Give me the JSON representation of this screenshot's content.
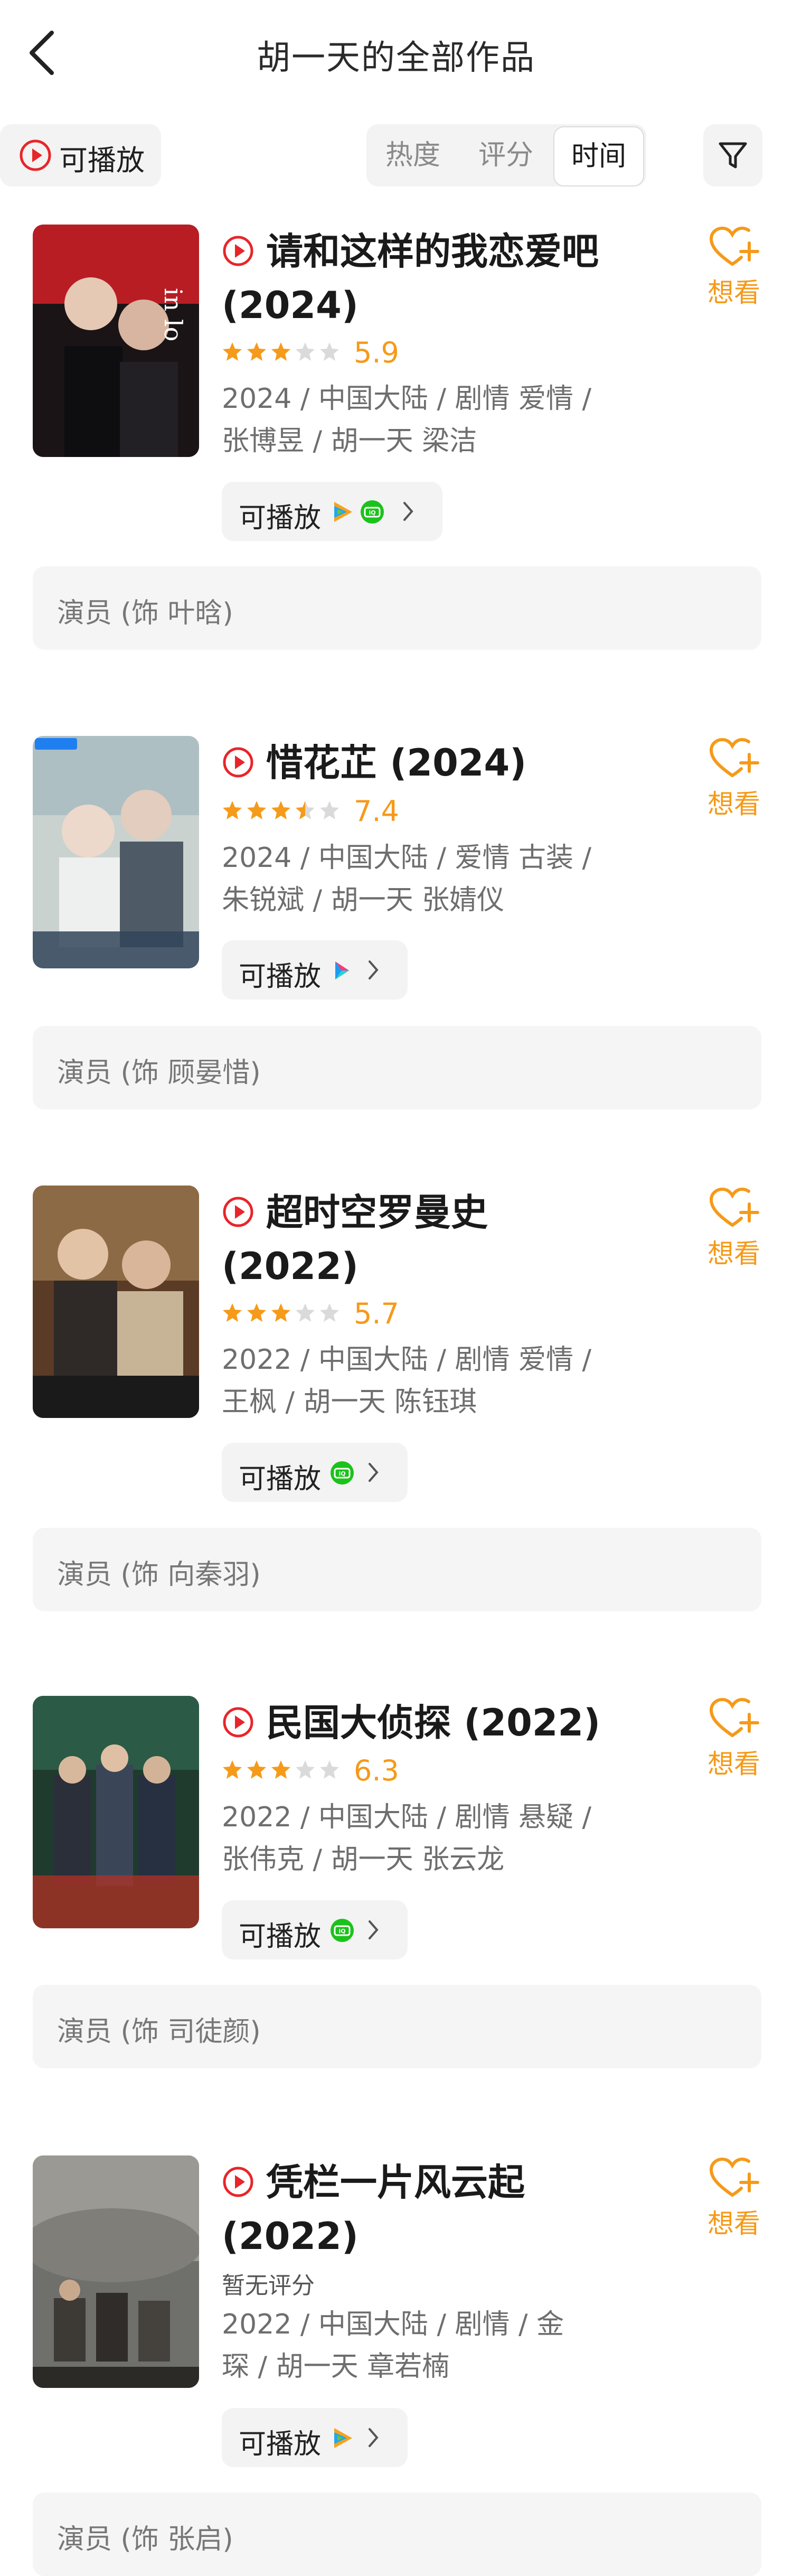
{
  "header": {
    "title": "胡一天的全部作品"
  },
  "filters": {
    "playable_label": "可播放",
    "sort_tabs": [
      "热度",
      "评分",
      "时间"
    ],
    "active_sort": "时间"
  },
  "common": {
    "want_label": "想看",
    "playable_label": "可播放"
  },
  "colors": {
    "accent": "#f59a19",
    "play_red": "#e8252a",
    "chip_bg": "#f3f3f3"
  },
  "movies": [
    {
      "title_line1": "请和这样的我恋爱吧",
      "title_line2": "(2024)",
      "stars": 3,
      "score": "5.9",
      "meta_line1": "2024 / 中国大陆 / 剧情 爱情 /",
      "meta_line2": "张博昱 / 胡一天 梁洁",
      "platforms": [
        "tencent-video",
        "iqiyi"
      ],
      "role": "演员 (饰 叶晗)"
    },
    {
      "title_line1": "惜花芷 (2024)",
      "title_line2": "",
      "stars": 3.5,
      "score": "7.4",
      "meta_line1": "2024 / 中国大陆 / 爱情 古装 /",
      "meta_line2": "朱锐斌 / 胡一天 张婧仪",
      "platforms": [
        "youku"
      ],
      "role": "演员 (饰 顾晏惜)"
    },
    {
      "title_line1": "超时空罗曼史",
      "title_line2": "(2022)",
      "stars": 3,
      "score": "5.7",
      "meta_line1": "2022 / 中国大陆 / 剧情 爱情 /",
      "meta_line2": "王枫 / 胡一天 陈钰琪",
      "platforms": [
        "iqiyi"
      ],
      "role": "演员 (饰 向秦羽)"
    },
    {
      "title_line1": "民国大侦探 (2022)",
      "title_line2": "",
      "stars": 3,
      "score": "6.3",
      "meta_line1": "2022 / 中国大陆 / 剧情 悬疑 /",
      "meta_line2": "张伟克 / 胡一天 张云龙",
      "platforms": [
        "iqiyi"
      ],
      "role": "演员 (饰 司徒颜)"
    },
    {
      "title_line1": "凭栏一片风云起",
      "title_line2": "(2022)",
      "no_score_text": "暂无评分",
      "meta_line1": "2022 / 中国大陆 / 剧情 / 金",
      "meta_line2": "琛 / 胡一天 章若楠",
      "platforms": [
        "tencent-video"
      ],
      "role": "演员 (饰 张启)"
    }
  ]
}
